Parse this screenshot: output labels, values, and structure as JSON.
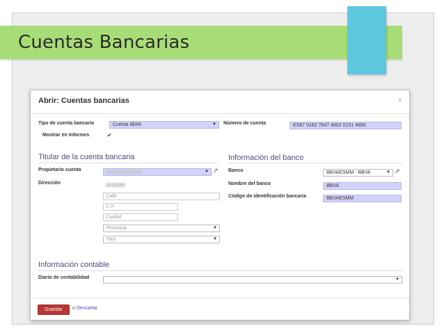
{
  "slide": {
    "title": "Cuentas Bancarias"
  },
  "dialog": {
    "title": "Abrir: Cuentas bancarias",
    "close": "×",
    "fields": {
      "tipo_label": "Tipo de cuenta bancaria",
      "tipo_value": "Cuenta IBAN",
      "mostrar_label": "Mostrar en Informes",
      "mostrar_checked": "✔",
      "numero_label": "Número de cuenta",
      "numero_value": "ES87 0182 7647 4802 0151 4856"
    },
    "titular": {
      "section": "Titular de la cuenta bancaria",
      "propietario_label": "Propietario cuenta",
      "direccion_label": "Dirección",
      "calle_placeholder": "Calle",
      "cp_placeholder": "C.P.",
      "ciudad_placeholder": "Ciudad",
      "provincia_placeholder": "Provincia",
      "pais_placeholder": "País"
    },
    "banco": {
      "section": "Información del banco",
      "banco_label": "Banco",
      "banco_value": "BBVAESMM - BBVA",
      "nombre_label": "Nombre del banco",
      "nombre_value": "BBVA",
      "codigo_label": "Código de identificación bancaria",
      "codigo_value": "BBVAESMM"
    },
    "contable": {
      "section": "Información contable",
      "diario_label": "Diario de contabilidad"
    },
    "footer": {
      "save": "Guardar",
      "or": "o",
      "discard": "Descartar"
    }
  },
  "icons": {
    "caret": "▼",
    "external_link": "⇗"
  },
  "colors": {
    "title_bar": "#a7dd76",
    "accent_tab": "#5dc7de",
    "save_button": "#b83636",
    "required_field": "#d2d2fa",
    "section_text": "#4c4c7a"
  }
}
